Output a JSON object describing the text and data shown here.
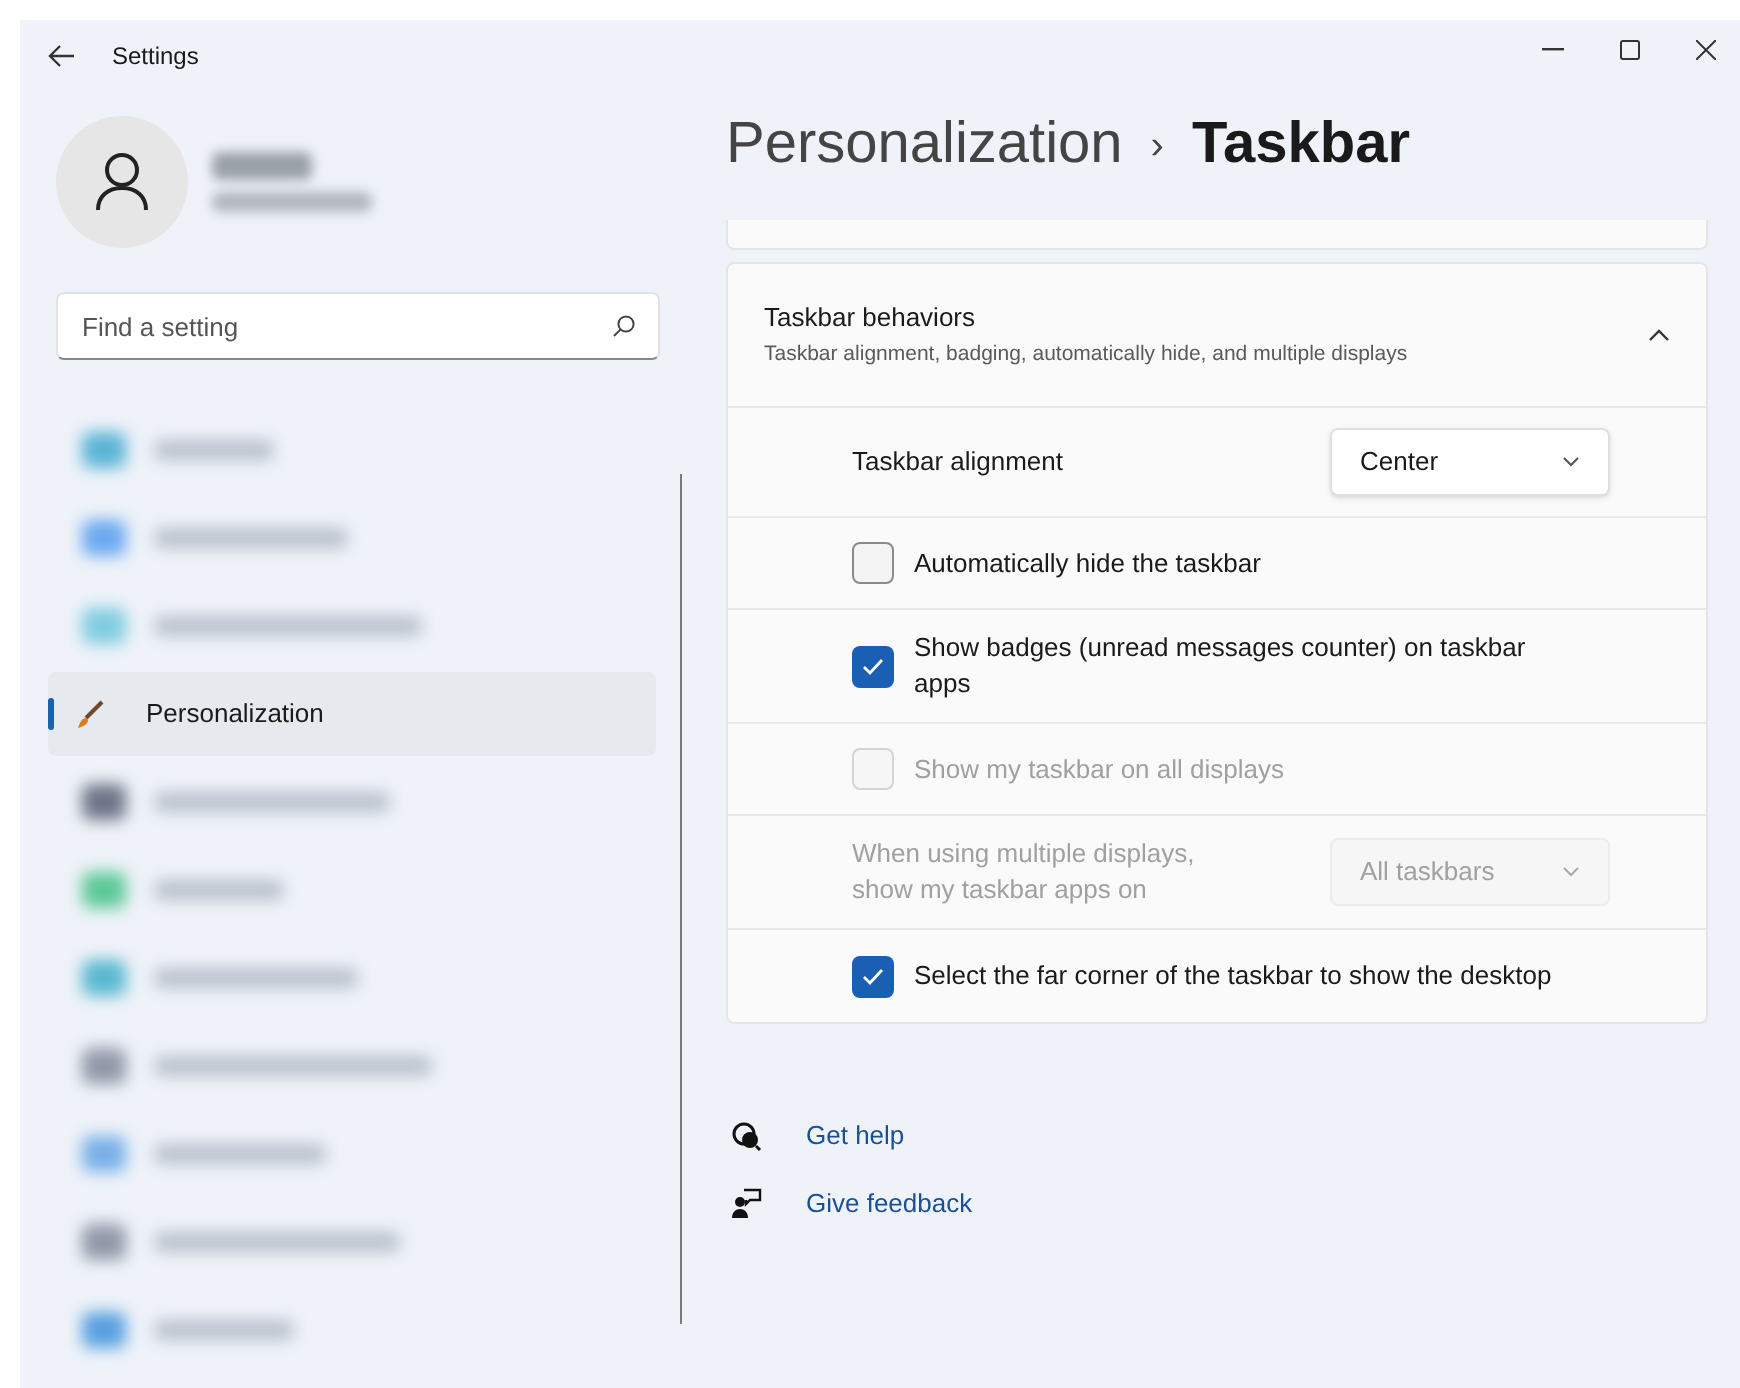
{
  "window": {
    "title": "Settings"
  },
  "account": {
    "kind": "blurred"
  },
  "search": {
    "placeholder": "Find a setting"
  },
  "sidebar": {
    "items": [
      {
        "kind": "blurred",
        "color": "#5ab4d6",
        "selected": false
      },
      {
        "kind": "blurred",
        "color": "#6aa8f0",
        "selected": false
      },
      {
        "kind": "blurred",
        "color": "#80cce0",
        "selected": false
      },
      {
        "kind": "item",
        "label": "Personalization",
        "selected": true
      },
      {
        "kind": "blurred",
        "color": "#6c7486",
        "selected": false
      },
      {
        "kind": "blurred",
        "color": "#5cc898",
        "selected": false
      },
      {
        "kind": "blurred",
        "color": "#58b8d0",
        "selected": false
      },
      {
        "kind": "blurred",
        "color": "#9098a8",
        "selected": false
      },
      {
        "kind": "blurred",
        "color": "#78b0e8",
        "selected": false
      },
      {
        "kind": "blurred",
        "color": "#9098a8",
        "selected": false
      },
      {
        "kind": "blurred",
        "color": "#58a0e0",
        "selected": false
      }
    ]
  },
  "breadcrumb": {
    "parent": "Personalization",
    "separator": "›",
    "current": "Taskbar"
  },
  "section": {
    "title": "Taskbar behaviors",
    "subtitle": "Taskbar alignment, badging, automatically hide, and multiple displays",
    "expanded": true,
    "rows": [
      {
        "kind": "dropdown",
        "label": "Taskbar alignment",
        "value": "Center",
        "disabled": false
      },
      {
        "kind": "checkbox",
        "label": "Automatically hide the taskbar",
        "checked": false,
        "disabled": false
      },
      {
        "kind": "checkbox",
        "label": "Show badges (unread messages counter) on taskbar apps",
        "checked": true,
        "disabled": false
      },
      {
        "kind": "checkbox",
        "label": "Show my taskbar on all displays",
        "checked": false,
        "disabled": true
      },
      {
        "kind": "dropdown",
        "label": "When using multiple displays, show my taskbar apps on",
        "value": "All taskbars",
        "disabled": true
      },
      {
        "kind": "checkbox",
        "label": "Select the far corner of the taskbar to show the desktop",
        "checked": true,
        "disabled": false
      }
    ]
  },
  "links": [
    {
      "kind": "help",
      "label": "Get help"
    },
    {
      "kind": "feedback",
      "label": "Give feedback"
    }
  ]
}
